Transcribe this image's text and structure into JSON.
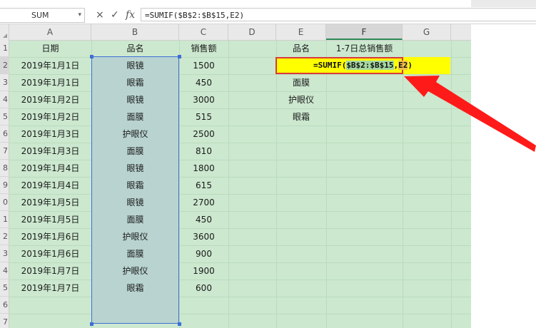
{
  "formula_bar": {
    "name_box": "SUM",
    "cancel_icon": "×",
    "confirm_icon": "✓",
    "fx_label": "fx",
    "formula": "=SUMIF($B$2:$B$15,E2)"
  },
  "columns": [
    "A",
    "B",
    "C",
    "D",
    "E",
    "F",
    "G"
  ],
  "rows": [
    "1",
    "2",
    "3",
    "4",
    "5",
    "6",
    "7",
    "8",
    "9",
    "0",
    "1",
    "2",
    "3",
    "4",
    "5",
    "6",
    "7"
  ],
  "headers": {
    "a1": "日期",
    "b1": "品名",
    "c1": "销售额",
    "e1": "品名",
    "f1": "1-7日总销售额"
  },
  "table": [
    {
      "date": "2019年1月1日",
      "product": "眼镜",
      "sales": "1500"
    },
    {
      "date": "2019年1月1日",
      "product": "眼霜",
      "sales": "450"
    },
    {
      "date": "2019年1月2日",
      "product": "眼镜",
      "sales": "3000"
    },
    {
      "date": "2019年1月2日",
      "product": "面膜",
      "sales": "515"
    },
    {
      "date": "2019年1月3日",
      "product": "护眼仪",
      "sales": "2500"
    },
    {
      "date": "2019年1月3日",
      "product": "面膜",
      "sales": "810"
    },
    {
      "date": "2019年1月4日",
      "product": "眼镜",
      "sales": "1800"
    },
    {
      "date": "2019年1月4日",
      "product": "眼霜",
      "sales": "615"
    },
    {
      "date": "2019年1月5日",
      "product": "眼镜",
      "sales": "2700"
    },
    {
      "date": "2019年1月5日",
      "product": "面膜",
      "sales": "450"
    },
    {
      "date": "2019年1月6日",
      "product": "护眼仪",
      "sales": "3600"
    },
    {
      "date": "2019年1月6日",
      "product": "面膜",
      "sales": "900"
    },
    {
      "date": "2019年1月7日",
      "product": "护眼仪",
      "sales": "1900"
    },
    {
      "date": "2019年1月7日",
      "product": "眼霜",
      "sales": "600"
    }
  ],
  "summary_items": [
    "面膜",
    "护眼仪",
    "眼霜"
  ],
  "f2": {
    "prefix": "=SUMIF(",
    "range_ref": "$B$2:$B$15",
    "sep": ",",
    "crit_ref": "E2",
    "suffix": ")"
  },
  "colors": {
    "grid_bg": "#cce8cf",
    "selection_fill": "#b9d4d0",
    "selection_border": "#3e6fd6",
    "highlight_yellow": "#ffff00",
    "arrow_red": "#ff1a1a"
  }
}
